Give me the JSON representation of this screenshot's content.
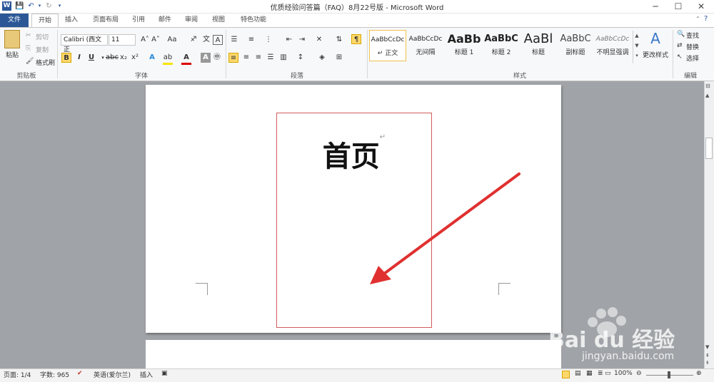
{
  "window": {
    "title": "优质经验问答篇（FAQ）8月22号版 - Microsoft Word",
    "controls": [
      "─",
      "☐",
      "✕"
    ]
  },
  "tabs": [
    "文件",
    "开始",
    "插入",
    "页面布局",
    "引用",
    "邮件",
    "审阅",
    "视图",
    "特色功能"
  ],
  "clipboard": {
    "paste": "粘贴",
    "cut": "剪切",
    "copy": "复制",
    "format_painter": "格式刷",
    "group_label": "剪贴板"
  },
  "font": {
    "font_name": "Calibri (西文正",
    "font_size": "11",
    "group_label": "字体"
  },
  "paragraph": {
    "group_label": "段落"
  },
  "styles": {
    "items": [
      {
        "sample": "AaBbCcDc",
        "name": "↵ 正文"
      },
      {
        "sample": "AaBbCcDc",
        "name": "无间隔"
      },
      {
        "sample": "AaBb",
        "name": "标题 1"
      },
      {
        "sample": "AaBbC",
        "name": "标题 2"
      },
      {
        "sample": "AaBl",
        "name": "标题"
      },
      {
        "sample": "AaBbC",
        "name": "副标题"
      },
      {
        "sample": "AaBbCcDc",
        "name": "不明显强调"
      }
    ],
    "change_styles": "更改样式",
    "group_label": "样式"
  },
  "editing": {
    "find": "查找",
    "replace": "替换",
    "select": "选择",
    "group_label": "编辑"
  },
  "document": {
    "heading": "首页",
    "paragraph_mark": "↵"
  },
  "status": {
    "page": "页面: 1/4",
    "words": "字数: 965",
    "language": "英语(爱尔兰)",
    "insert": "插入",
    "zoom": "100%"
  },
  "watermark": {
    "brand": "Bai du 经验",
    "url": "jingyan.baidu.com"
  },
  "colors": {
    "file_tab": "#2b5797",
    "textbox_border": "#d35b5b",
    "arrow": "#e03030",
    "highlight": "#ffd86b"
  }
}
